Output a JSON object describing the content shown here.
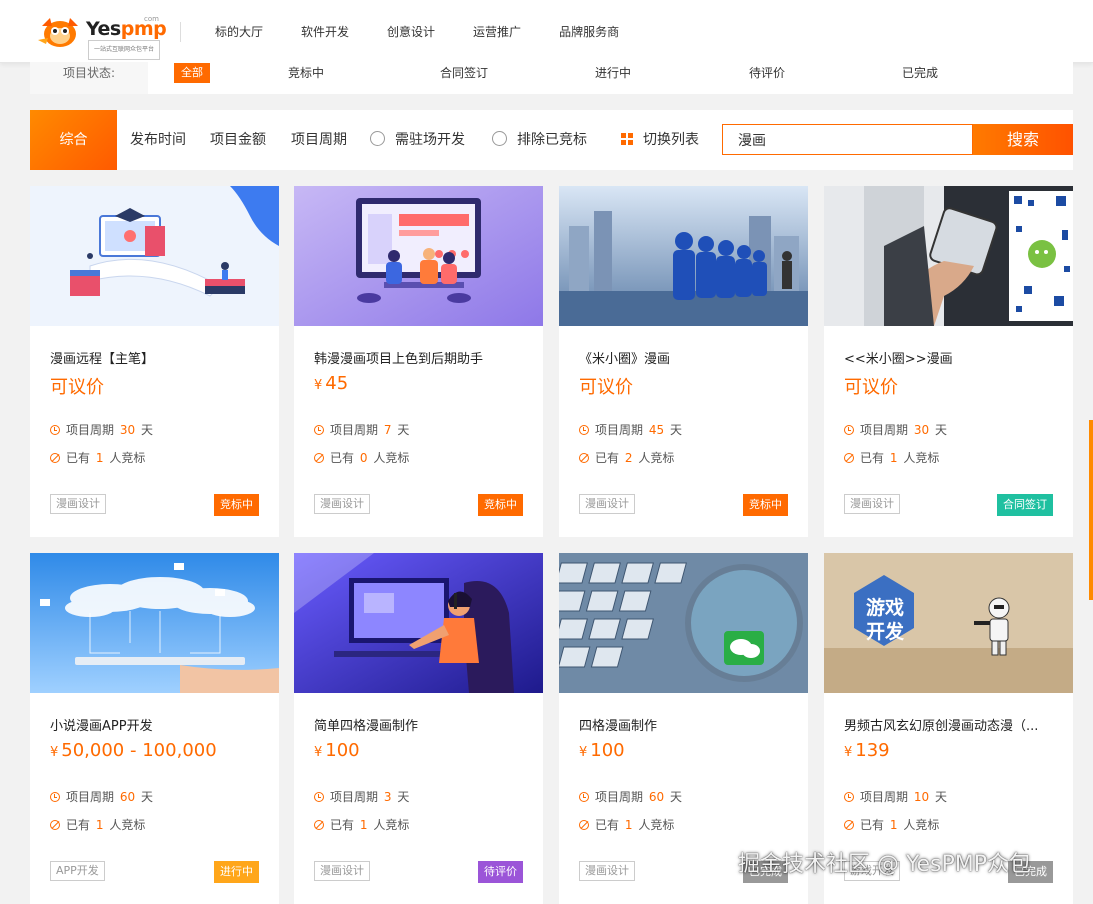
{
  "logo": {
    "brand_a": "Yes",
    "brand_b": "pmp",
    "tld": "com",
    "tagline": "一站式互联网众包平台"
  },
  "nav": [
    "标的大厅",
    "软件开发",
    "创意设计",
    "运营推广",
    "品牌服务商"
  ],
  "status": {
    "label": "项目状态:",
    "options": [
      "全部",
      "竞标中",
      "合同签订",
      "进行中",
      "待评价",
      "已完成"
    ],
    "active": "全部"
  },
  "filter": {
    "main_tab": "综合",
    "sorts": [
      "发布时间",
      "项目金额",
      "项目周期"
    ],
    "onsite": "需驻场开发",
    "exclude": "排除已竞标",
    "toggle_view": "切换列表",
    "search_value": "漫画",
    "search_button": "搜索"
  },
  "labels": {
    "period": "项目周期",
    "unit": "天",
    "bid_prefix": "已有",
    "bid_suffix": "人竞标",
    "currency": "¥",
    "range_sep": "-"
  },
  "colors": {
    "accent": "#ff6a00",
    "bidding": "#ff6a00",
    "contract": "#1fc0a0",
    "ongoing": "#ffa61a",
    "review": "#9b55d8",
    "done": "#999999"
  },
  "cards": [
    {
      "title": "漫画远程【主笔】",
      "price": "可议价",
      "negotiable": true,
      "period": "30",
      "bidders": "1",
      "tag": "漫画设计",
      "status": "竞标中",
      "status_color": "#ff6a00",
      "thumb": "education-illustration"
    },
    {
      "title": "韩漫漫画项目上色到后期助手",
      "price": "45",
      "negotiable": false,
      "period": "7",
      "bidders": "0",
      "tag": "漫画设计",
      "status": "竞标中",
      "status_color": "#ff6a00",
      "thumb": "team-meeting-illustration"
    },
    {
      "title": "《米小圈》漫画",
      "price": "可议价",
      "negotiable": true,
      "period": "45",
      "bidders": "2",
      "tag": "漫画设计",
      "status": "竞标中",
      "status_color": "#ff6a00",
      "thumb": "blue-figures-city"
    },
    {
      "title": "<<米小圈>>漫画",
      "price": "可议价",
      "negotiable": true,
      "period": "30",
      "bidders": "1",
      "tag": "漫画设计",
      "status": "合同签订",
      "status_color": "#1fc0a0",
      "thumb": "phone-wechat"
    },
    {
      "title": "小说漫画APP开发",
      "price": "50,000",
      "price_max": "100,000",
      "negotiable": false,
      "period": "60",
      "bidders": "1",
      "tag": "APP开发",
      "status": "进行中",
      "status_color": "#ffa61a",
      "thumb": "cloud-tablet"
    },
    {
      "title": "简单四格漫画制作",
      "price": "100",
      "negotiable": false,
      "period": "3",
      "bidders": "1",
      "tag": "漫画设计",
      "status": "待评价",
      "status_color": "#9b55d8",
      "thumb": "gamer-illustration"
    },
    {
      "title": "四格漫画制作",
      "price": "100",
      "negotiable": false,
      "period": "60",
      "bidders": "1",
      "tag": "漫画设计",
      "status": "已完成",
      "status_color": "#999999",
      "thumb": "keyboard-wechat"
    },
    {
      "title": "男频古风玄幻原创漫画动态漫（...",
      "price": "139",
      "negotiable": false,
      "period": "10",
      "bidders": "1",
      "tag": "游戏开发",
      "status": "已完成",
      "status_color": "#999999",
      "thumb": "game-dev-stormtrooper",
      "thumb_text": [
        "游戏",
        "开发"
      ]
    }
  ],
  "watermark": "掘金技术社区 @ YesPMP众包"
}
